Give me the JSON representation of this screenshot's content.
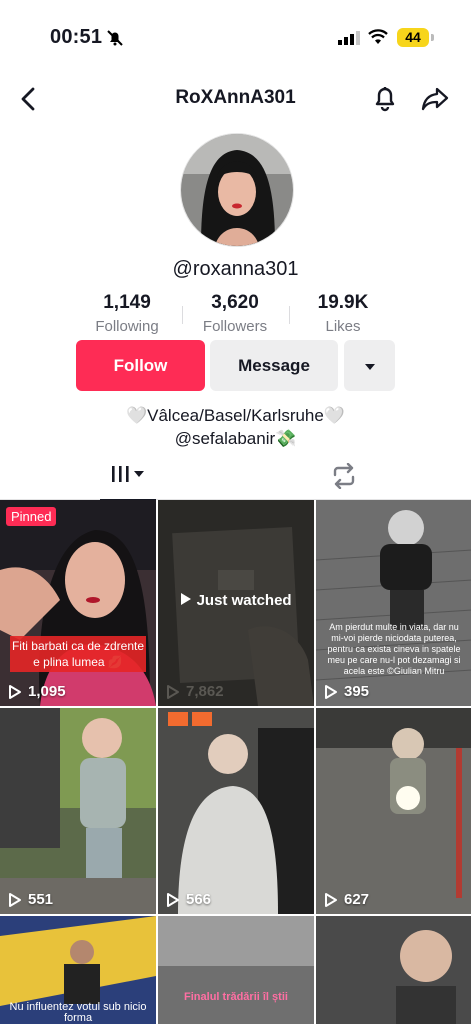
{
  "status": {
    "time": "00:51",
    "battery": "44"
  },
  "nav": {
    "title": "RoXAnnA301"
  },
  "profile": {
    "username": "@roxanna301",
    "stats": [
      {
        "value": "1,149",
        "label": "Following"
      },
      {
        "value": "3,620",
        "label": "Followers"
      },
      {
        "value": "19.9K",
        "label": "Likes"
      }
    ],
    "follow_label": "Follow",
    "message_label": "Message",
    "bio_line1": "🤍Vâlcea/Basel/Karlsruhe🤍",
    "bio_line2": "@sefalabanir💸"
  },
  "videos": [
    {
      "views": "1,095",
      "badge": "Pinned",
      "caption": "Fiti barbati ca de zdrente e plina lumea 💋"
    },
    {
      "views": "7,862",
      "label": "Just watched"
    },
    {
      "views": "395",
      "caption": "Am pierdut multe in viata, dar nu mi-voi pierde niciodata puterea, pentru ca exista cineva in spatele meu pe care nu-l pot dezamagi si acela este ©Giulian Mitru"
    },
    {
      "views": "551"
    },
    {
      "views": "566"
    },
    {
      "views": "627"
    },
    {
      "views": "",
      "caption": "Nu influentez votul sub nicio forma"
    },
    {
      "views": "",
      "caption": "Finalul trădării îl știi"
    },
    {
      "views": ""
    }
  ],
  "colors": {
    "accent": "#fe2c55",
    "battery": "#f7d51b"
  }
}
